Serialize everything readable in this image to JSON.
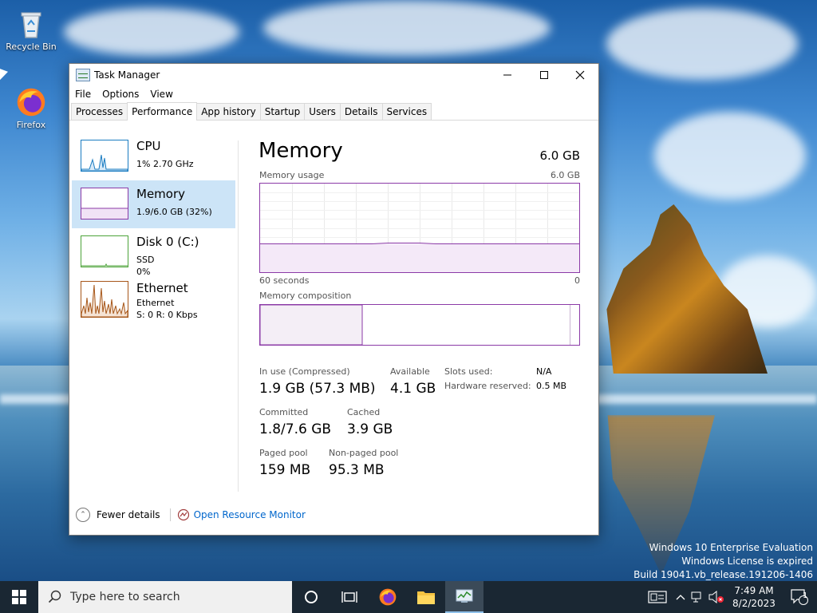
{
  "desktop": {
    "icons": [
      {
        "label": "Recycle Bin",
        "icon": "recycle-bin-icon"
      },
      {
        "label": "Firefox",
        "icon": "firefox-icon"
      }
    ],
    "watermark": [
      "Windows 10 Enterprise Evaluation",
      "Windows License is expired",
      "Build 19041.vb_release.191206-1406"
    ]
  },
  "window": {
    "title": "Task Manager",
    "menu": [
      "File",
      "Options",
      "View"
    ],
    "tabs": [
      "Processes",
      "Performance",
      "App history",
      "Startup",
      "Users",
      "Details",
      "Services"
    ],
    "active_tab": "Performance"
  },
  "sidebar": {
    "items": [
      {
        "name": "CPU",
        "sub1": "1%  2.70 GHz",
        "sub2": "",
        "color": "#1a7cc1"
      },
      {
        "name": "Memory",
        "sub1": "1.9/6.0 GB (32%)",
        "sub2": "",
        "color": "#8b3aa7"
      },
      {
        "name": "Disk 0 (C:)",
        "sub1": "SSD",
        "sub2": "0%",
        "color": "#4da33a"
      },
      {
        "name": "Ethernet",
        "sub1": "Ethernet",
        "sub2": "S: 0 R: 0 Kbps",
        "color": "#a7571a"
      }
    ],
    "active": "Memory"
  },
  "memory": {
    "title": "Memory",
    "total": "6.0 GB",
    "usage_label": "Memory usage",
    "usage_max": "6.0 GB",
    "axis_left": "60 seconds",
    "axis_right": "0",
    "usage_fraction": 0.32,
    "composition_label": "Memory composition",
    "composition_in_use_fraction": 0.32,
    "stats": {
      "in_use_label": "In use (Compressed)",
      "in_use_value": "1.9 GB (57.3 MB)",
      "available_label": "Available",
      "available_value": "4.1 GB",
      "committed_label": "Committed",
      "committed_value": "1.8/7.6 GB",
      "cached_label": "Cached",
      "cached_value": "3.9 GB",
      "paged_label": "Paged pool",
      "paged_value": "159 MB",
      "nonpaged_label": "Non-paged pool",
      "nonpaged_value": "95.3 MB",
      "slots_label": "Slots used:",
      "slots_value": "N/A",
      "hw_reserved_label": "Hardware reserved:",
      "hw_reserved_value": "0.5 MB"
    }
  },
  "footer": {
    "fewer_details": "Fewer details",
    "resource_monitor": "Open Resource Monitor"
  },
  "taskbar": {
    "search_placeholder": "Type here to search",
    "time": "7:49 AM",
    "date": "8/2/2023",
    "notification_count": "1"
  }
}
